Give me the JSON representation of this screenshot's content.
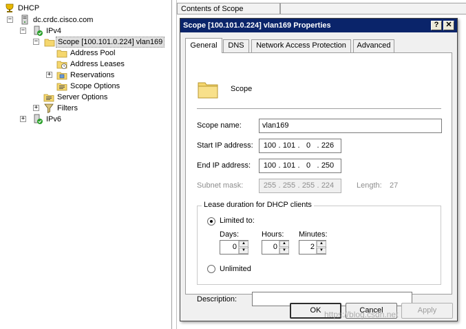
{
  "tree": {
    "root": "DHCP",
    "server": "dc.crdc.cisco.com",
    "ipv4": "IPv4",
    "scope": "Scope [100.101.0.224] vlan169",
    "address_pool": "Address Pool",
    "address_leases": "Address Leases",
    "reservations": "Reservations",
    "scope_options": "Scope Options",
    "server_options": "Server Options",
    "filters": "Filters",
    "ipv6": "IPv6",
    "expander_plus": "+",
    "expander_minus": "−"
  },
  "right_pane": {
    "column_header": "Contents of Scope"
  },
  "dialog": {
    "title": "Scope [100.101.0.224] vlan169 Properties",
    "help_btn": "?",
    "close_btn": "✕",
    "tabs": [
      "General",
      "DNS",
      "Network Access Protection",
      "Advanced"
    ],
    "header_label": "Scope",
    "scope_name_label": "Scope name:",
    "scope_name_value": "vlan169",
    "start_ip_label": "Start IP address:",
    "start_ip": [
      "100",
      "101",
      "0",
      "226"
    ],
    "end_ip_label": "End IP address:",
    "end_ip": [
      "100",
      "101",
      "0",
      "250"
    ],
    "subnet_label": "Subnet mask:",
    "subnet": [
      "255",
      "255",
      "255",
      "224"
    ],
    "length_label": "Length:",
    "length_value": "27",
    "ip_dot": ".",
    "lease_group_title": "Lease duration for DHCP clients",
    "limited_label": "Limited to:",
    "days_label": "Days:",
    "days_value": "0",
    "hours_label": "Hours:",
    "hours_value": "0",
    "minutes_label": "Minutes:",
    "minutes_value": "2",
    "spin_up": "▲",
    "spin_down": "▼",
    "unlimited_label": "Unlimited",
    "lease_mode": "limited",
    "description_label": "Description:",
    "description_value": "",
    "ok_label": "OK",
    "cancel_label": "Cancel",
    "apply_label": "Apply"
  },
  "watermark": "https://blog.csdn.net",
  "colors": {
    "titlebar": "#0a246a",
    "folder": "#f5d76e",
    "dialog_bg": "#f0f0f0"
  },
  "icons": {
    "dhcp": "trophy-dhcp-icon",
    "server": "server-icon",
    "ipv4": "ipv4-green-check-icon",
    "scope": "folder-icon",
    "pool": "address-pool-icon",
    "leases": "address-leases-icon",
    "reservations": "reservations-icon",
    "scope_options": "options-icon",
    "filters": "filter-icon"
  }
}
